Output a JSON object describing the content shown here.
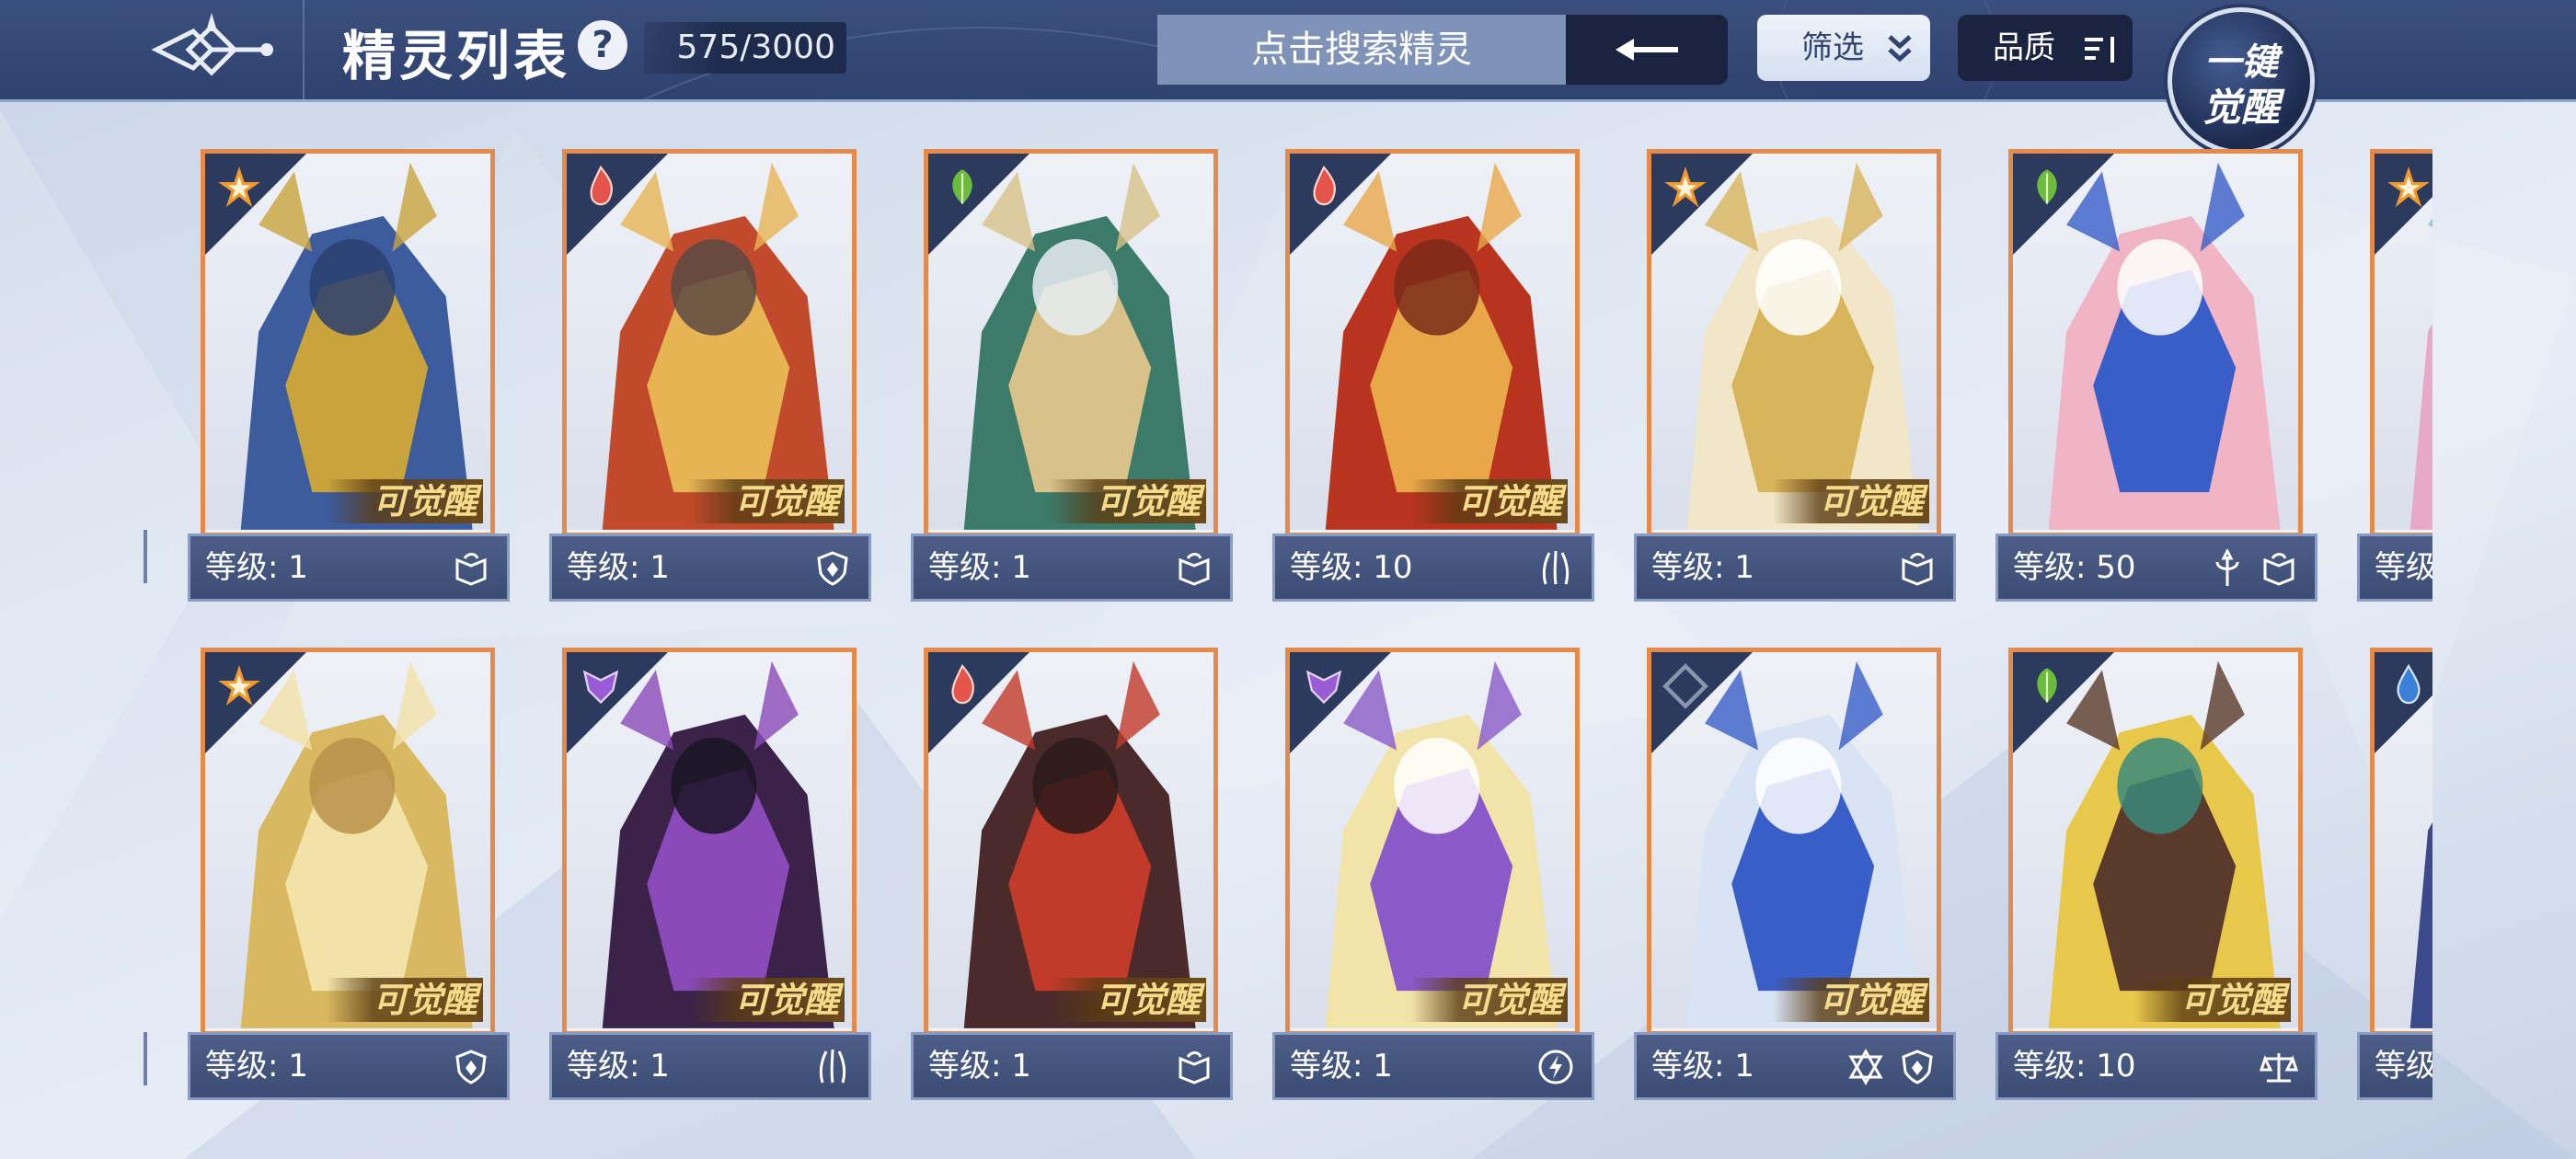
{
  "header": {
    "title": "精灵列表",
    "help_label": "?",
    "count": "575/3000",
    "search_placeholder": "点击搜索精灵",
    "filter_label": "筛选",
    "quality_label": "品质",
    "awaken_line1": "一键",
    "awaken_line2": "觉醒"
  },
  "colors": {
    "light": "#f29a2e",
    "fire": "#e4544a",
    "grass": "#6cbb3c",
    "dark": "#9a5cd6",
    "water": "#3a7fd8",
    "neutral": "#cfd6e2",
    "frame": "#e48a4a"
  },
  "cards": [
    {
      "level": "等级: 1",
      "awaken": "可觉醒",
      "element": "light",
      "traits": [
        "book-icon"
      ]
    },
    {
      "level": "等级: 1",
      "awaken": "可觉醒",
      "element": "fire",
      "traits": [
        "shield-icon"
      ]
    },
    {
      "level": "等级: 1",
      "awaken": "可觉醒",
      "element": "grass",
      "traits": [
        "book-icon"
      ]
    },
    {
      "level": "等级: 10",
      "awaken": "可觉醒",
      "element": "fire",
      "traits": [
        "claw-icon"
      ]
    },
    {
      "level": "等级: 1",
      "awaken": "可觉醒",
      "element": "light",
      "traits": [
        "book-icon"
      ]
    },
    {
      "level": "等级: 50",
      "awaken": "",
      "element": "grass",
      "traits": [
        "trident-icon",
        "book-icon"
      ]
    },
    {
      "level": "等级",
      "awaken": "",
      "element": "light",
      "traits": []
    },
    {
      "level": "等级: 1",
      "awaken": "可觉醒",
      "element": "light",
      "traits": [
        "shield-icon"
      ]
    },
    {
      "level": "等级: 1",
      "awaken": "可觉醒",
      "element": "dark",
      "traits": [
        "claw-icon"
      ]
    },
    {
      "level": "等级: 1",
      "awaken": "可觉醒",
      "element": "fire",
      "traits": [
        "book-icon"
      ]
    },
    {
      "level": "等级: 1",
      "awaken": "可觉醒",
      "element": "dark",
      "traits": [
        "lightning-icon"
      ]
    },
    {
      "level": "等级: 1",
      "awaken": "可觉醒",
      "element": "neutral",
      "traits": [
        "star-icon",
        "shield-icon"
      ]
    },
    {
      "level": "等级: 10",
      "awaken": "可觉醒",
      "element": "grass",
      "traits": [
        "scales-icon"
      ]
    },
    {
      "level": "等级",
      "awaken": "",
      "element": "water",
      "traits": []
    }
  ]
}
